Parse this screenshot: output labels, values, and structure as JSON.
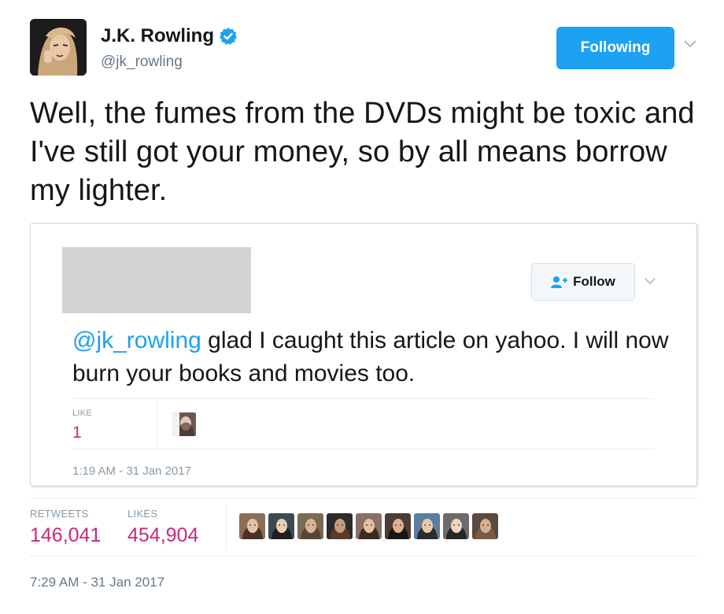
{
  "author": {
    "name": "J.K. Rowling",
    "handle": "@jk_rowling",
    "verified": true,
    "following_label": "Following"
  },
  "tweet": {
    "text": "Well, the fumes from the DVDs might be toxic and I've still got your money, so by all means borrow my lighter.",
    "timestamp": "7:29 AM - 31 Jan 2017",
    "retweets_label": "RETWEETS",
    "retweets": "146,041",
    "likes_label": "LIKES",
    "likes": "454,904",
    "liker_count": 9
  },
  "quoted": {
    "follow_label": "Follow",
    "mention": "@jk_rowling",
    "text": " glad I caught this article on yahoo. I will now burn your books and movies too.",
    "like_label": "LIKE",
    "like_count": "1",
    "timestamp": "1:19 AM - 31 Jan 2017"
  },
  "colors": {
    "accent": "#1da1f2",
    "likes": "#c6297d",
    "muted": "#8899a6"
  }
}
